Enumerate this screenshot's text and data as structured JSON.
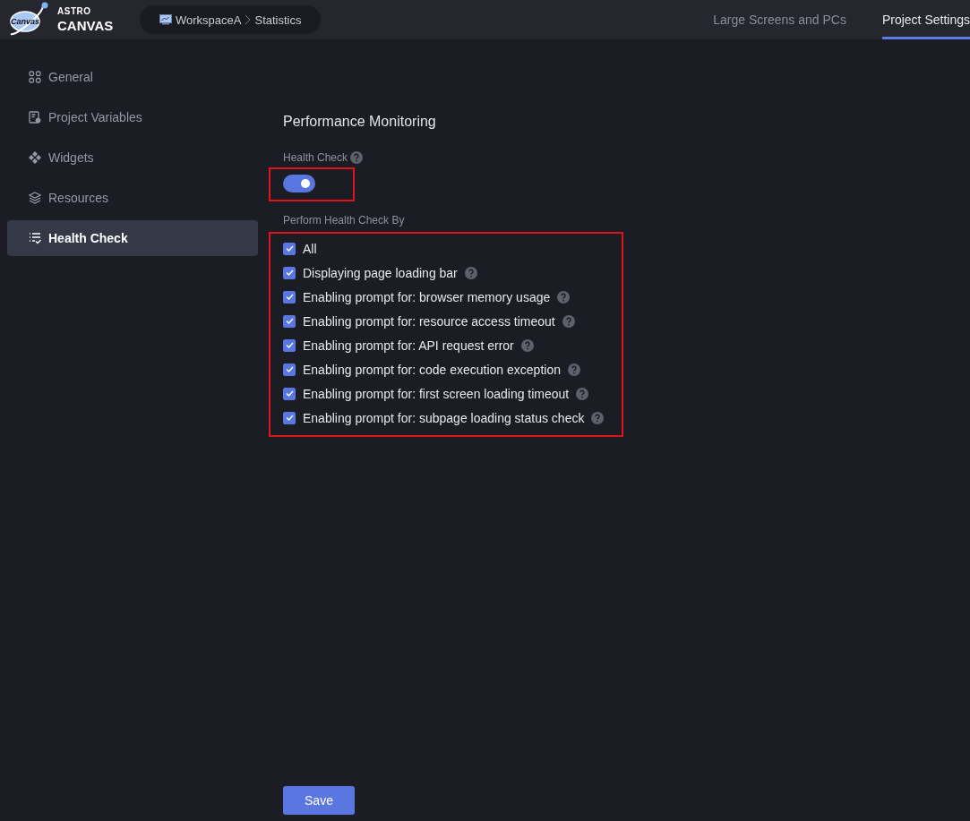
{
  "logo": {
    "badge": "Canvas",
    "brand_top": "ASTRO",
    "brand_bottom": "CANVAS"
  },
  "breadcrumb": [
    "WorkspaceA",
    "Statistics"
  ],
  "tabs": [
    {
      "label": "Large Screens and PCs",
      "selected": false
    },
    {
      "label": "Project Settings",
      "selected": true
    }
  ],
  "sidebar": {
    "items": [
      {
        "label": "General",
        "selected": false
      },
      {
        "label": "Project Variables",
        "selected": false
      },
      {
        "label": "Widgets",
        "selected": false
      },
      {
        "label": "Resources",
        "selected": false
      },
      {
        "label": "Health Check",
        "selected": true
      }
    ]
  },
  "section_title": "Performance Monitoring",
  "health_check": {
    "label": "Health Check",
    "on": true
  },
  "options_label": "Perform Health Check By",
  "options": [
    {
      "label": "All",
      "checked": true,
      "help": false
    },
    {
      "label": "Displaying page loading bar",
      "checked": true,
      "help": true
    },
    {
      "label": "Enabling prompt for: browser memory usage",
      "checked": true,
      "help": true
    },
    {
      "label": "Enabling prompt for: resource access timeout",
      "checked": true,
      "help": true
    },
    {
      "label": "Enabling prompt for: API request error",
      "checked": true,
      "help": true
    },
    {
      "label": "Enabling prompt for: code execution exception",
      "checked": true,
      "help": true
    },
    {
      "label": "Enabling prompt for: first screen loading timeout",
      "checked": true,
      "help": true
    },
    {
      "label": "Enabling prompt for: subpage loading status check",
      "checked": true,
      "help": true
    }
  ],
  "save_button": "Save"
}
